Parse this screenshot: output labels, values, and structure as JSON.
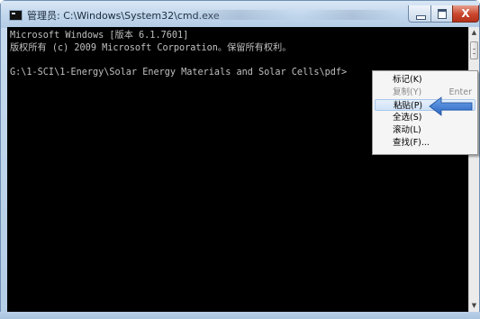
{
  "window": {
    "title": "管理员: C:\\Windows\\System32\\cmd.exe",
    "close_symbol": "X"
  },
  "console": {
    "lines": [
      "Microsoft Windows [版本 6.1.7601]",
      "版权所有 (c) 2009 Microsoft Corporation。保留所有权利。",
      "",
      "G:\\1-SCI\\1-Energy\\Solar Energy Materials and Solar Cells\\pdf>"
    ],
    "colors": {
      "background": "#000000",
      "text": "#c0c0c0"
    }
  },
  "context_menu": {
    "items": [
      {
        "label": "标记(K)",
        "shortcut": "",
        "disabled": false,
        "highlighted": false
      },
      {
        "label": "复制(Y)",
        "shortcut": "Enter",
        "disabled": true,
        "highlighted": false
      },
      {
        "label": "粘贴(P)",
        "shortcut": "",
        "disabled": false,
        "highlighted": true
      },
      {
        "label": "全选(S)",
        "shortcut": "",
        "disabled": false,
        "highlighted": false
      },
      {
        "label": "滚动(L)",
        "shortcut": "",
        "disabled": false,
        "highlighted": false
      },
      {
        "label": "查找(F)...",
        "shortcut": "",
        "disabled": false,
        "highlighted": false
      }
    ]
  },
  "annotation": {
    "arrow_color": "#3a7bd5",
    "points_to": "粘贴(P)"
  },
  "icons": [
    "cmd-app-icon",
    "minimize-icon",
    "maximize-icon",
    "close-icon",
    "scroll-up-icon",
    "scroll-down-icon",
    "arrow-pointer-icon"
  ]
}
